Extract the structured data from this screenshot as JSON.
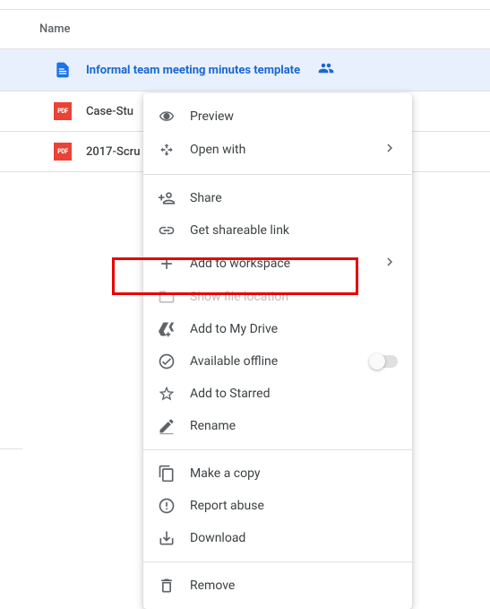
{
  "header": {
    "name_column": "Name"
  },
  "files": [
    {
      "name": "Informal team meeting minutes template",
      "type": "doc",
      "shared": true,
      "selected": true
    },
    {
      "name": "Case-Stu",
      "type": "pdf",
      "shared": false,
      "selected": false
    },
    {
      "name": "2017-Scru",
      "type": "pdf",
      "shared": false,
      "selected": false
    }
  ],
  "pdf_badge": "PDF",
  "menu": {
    "preview": "Preview",
    "open_with": "Open with",
    "share": "Share",
    "get_link": "Get shareable link",
    "add_workspace": "Add to workspace",
    "show_location": "Show file location",
    "add_drive": "Add to My Drive",
    "offline": "Available offline",
    "add_starred": "Add to Starred",
    "rename": "Rename",
    "make_copy": "Make a copy",
    "report_abuse": "Report abuse",
    "download": "Download",
    "remove": "Remove"
  }
}
